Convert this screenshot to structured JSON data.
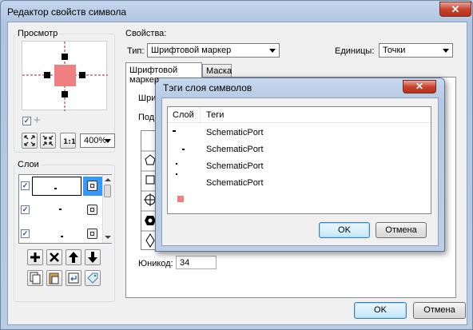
{
  "window": {
    "title": "Редактор свойств символа",
    "close_glyph": "✕"
  },
  "preview": {
    "label": "Просмотр",
    "zoom": "400%",
    "marker_color": "#f08080"
  },
  "layers": {
    "label": "Слои"
  },
  "properties": {
    "label": "Свойства:",
    "type_label": "Тип:",
    "type_value": "Шрифтовой маркер",
    "units_label": "Единицы:",
    "units_value": "Точки",
    "tabs": [
      "Шрифтовой маркер",
      "Маска"
    ],
    "partial_label_1": "Шриф",
    "partial_label_2": "Подн",
    "unicode_label": "Юникод:",
    "unicode_value": "34"
  },
  "footer": {
    "ok_label": "OK",
    "cancel_label": "Отмена"
  },
  "tags_dialog": {
    "title": "Тэги слоя символов",
    "close_glyph": "✕",
    "col_layer": "Слой",
    "col_tags": "Теги",
    "rows": [
      {
        "tag": "SchematicPort"
      },
      {
        "tag": "SchematicPort"
      },
      {
        "tag": "SchematicPort"
      },
      {
        "tag": "SchematicPort"
      },
      {
        "tag": ""
      }
    ],
    "ok_label": "OK",
    "cancel_label": "Отмена"
  }
}
